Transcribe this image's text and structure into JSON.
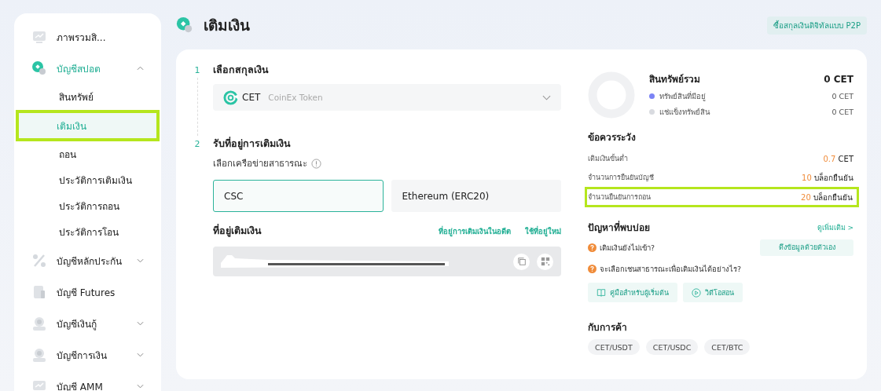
{
  "sidebar": {
    "items": [
      {
        "label": "ภาพรวมสิ...",
        "kind": "chart",
        "active": false
      },
      {
        "label": "บัญชีสปอต",
        "kind": "coin",
        "active": true,
        "expanded": true,
        "children": [
          {
            "label": "สินทรัพย์",
            "selected": false,
            "highlighted": false
          },
          {
            "label": "เติมเงิน",
            "selected": true,
            "highlighted": true
          },
          {
            "label": "ถอน",
            "selected": false,
            "highlighted": false
          },
          {
            "label": "ประวัติการเติมเงิน",
            "selected": false,
            "highlighted": false
          },
          {
            "label": "ประวัติการถอน",
            "selected": false,
            "highlighted": false
          },
          {
            "label": "ประวัติการโอน",
            "selected": false,
            "highlighted": false
          }
        ]
      },
      {
        "label": "บัญชีหลักประกัน",
        "kind": "percent",
        "active": false,
        "expanded": false
      },
      {
        "label": "บัญชี Futures",
        "kind": "doc",
        "active": false
      },
      {
        "label": "บัญชีเงินกู้",
        "kind": "person",
        "active": false,
        "expanded": false
      },
      {
        "label": "บัญชีการเงิน",
        "kind": "person",
        "active": false,
        "expanded": false
      },
      {
        "label": "บัญชี AMM",
        "kind": "chart",
        "active": false,
        "expanded": false
      }
    ]
  },
  "page": {
    "title": "เติมเงิน",
    "p2p_button": "ซื้อสกุลเงินดิจิทัลแบบ P2P"
  },
  "steps": [
    {
      "number": "1",
      "title": "เลือกสกุลเงิน"
    },
    {
      "number": "2",
      "title": "รับที่อยู่การเติมเงิน"
    }
  ],
  "currency_select": {
    "symbol": "CET",
    "name": "CoinEx Token"
  },
  "network": {
    "label": "เลือกเครือข่ายสาธารณะ",
    "options": [
      {
        "label": "CSC",
        "selected": true
      },
      {
        "label": "Ethereum (ERC20)",
        "selected": false
      }
    ]
  },
  "address": {
    "label": "ที่อยู่เติมเงิน",
    "links": [
      "ที่อยู่การเติมเงินในอดีต",
      "ใช้ที่อยู่ใหม่"
    ]
  },
  "assets": {
    "title": "สินทรัพย์รวม",
    "total": "0 CET",
    "rows": [
      {
        "label": "ทรัพย์สินที่มีอยู่",
        "value": "0 CET",
        "color": "#7b83f5"
      },
      {
        "label": "แช่แข็งทรัพย์สิน",
        "value": "0 CET",
        "color": "#d9dbe0"
      }
    ]
  },
  "notes": {
    "title": "ข้อควรระวัง",
    "rows": [
      {
        "label": "เติมเงินขั้นต่ำ",
        "number": "0.7",
        "unit": "CET",
        "highlighted": false
      },
      {
        "label": "จำนวนการยืนยันบัญชี",
        "number": "10",
        "unit": "บล็อกยืนยัน",
        "highlighted": false
      },
      {
        "label": "จำนวนยืนยันการถอน",
        "number": "20",
        "unit": "บล็อกยืนยัน",
        "highlighted": true
      }
    ]
  },
  "faq": {
    "title": "ปัญหาที่พบบ่อย",
    "more": "ดูเพิ่มเติม",
    "more_icon": ">",
    "questions": [
      {
        "text": "เติมเงินยังไม่เข้า?",
        "action": "ดึงข้อมูลด้วยตัวเอง"
      },
      {
        "text": "จะเลือกเชนสาธารณะเพื่อเติมเงินได้อย่างไร?"
      }
    ],
    "guides": [
      {
        "kind": "book",
        "label": "คู่มือสำหรับผู้เริ่มต้น"
      },
      {
        "kind": "video",
        "label": "วิดีโอสอน"
      }
    ]
  },
  "trade": {
    "title": "กับการค้า",
    "pairs": [
      "CET/USDT",
      "CET/USDC",
      "CET/BTC"
    ]
  }
}
